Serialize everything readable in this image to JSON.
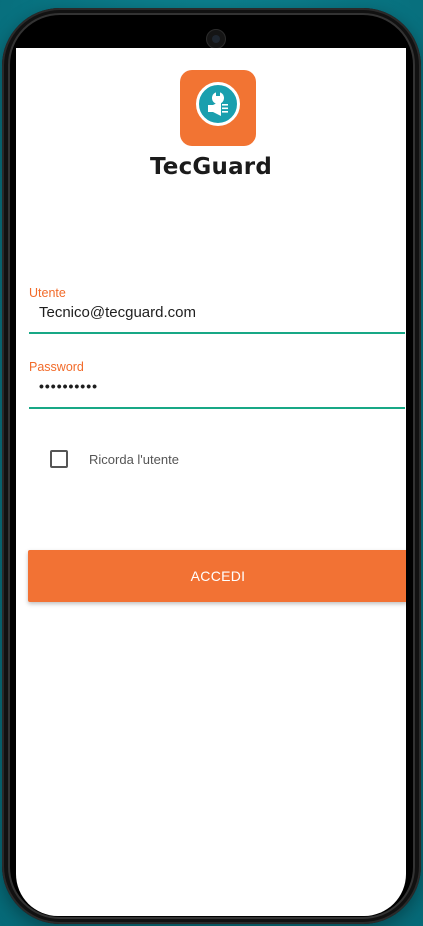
{
  "app": {
    "name": "TecGuard",
    "brand_color": "#f27433",
    "accent_color": "#18a886"
  },
  "login": {
    "username_label": "Utente",
    "username_value": "Tecnico@tecguard.com",
    "password_label": "Password",
    "password_value": "••••••••••",
    "remember_label": "Ricorda l'utente",
    "remember_checked": false,
    "submit_label": "ACCEDI"
  },
  "icons": {
    "logo": "wrench-megaphone-icon",
    "checkbox": "checkbox-unchecked-icon",
    "camera": "front-camera-icon"
  }
}
